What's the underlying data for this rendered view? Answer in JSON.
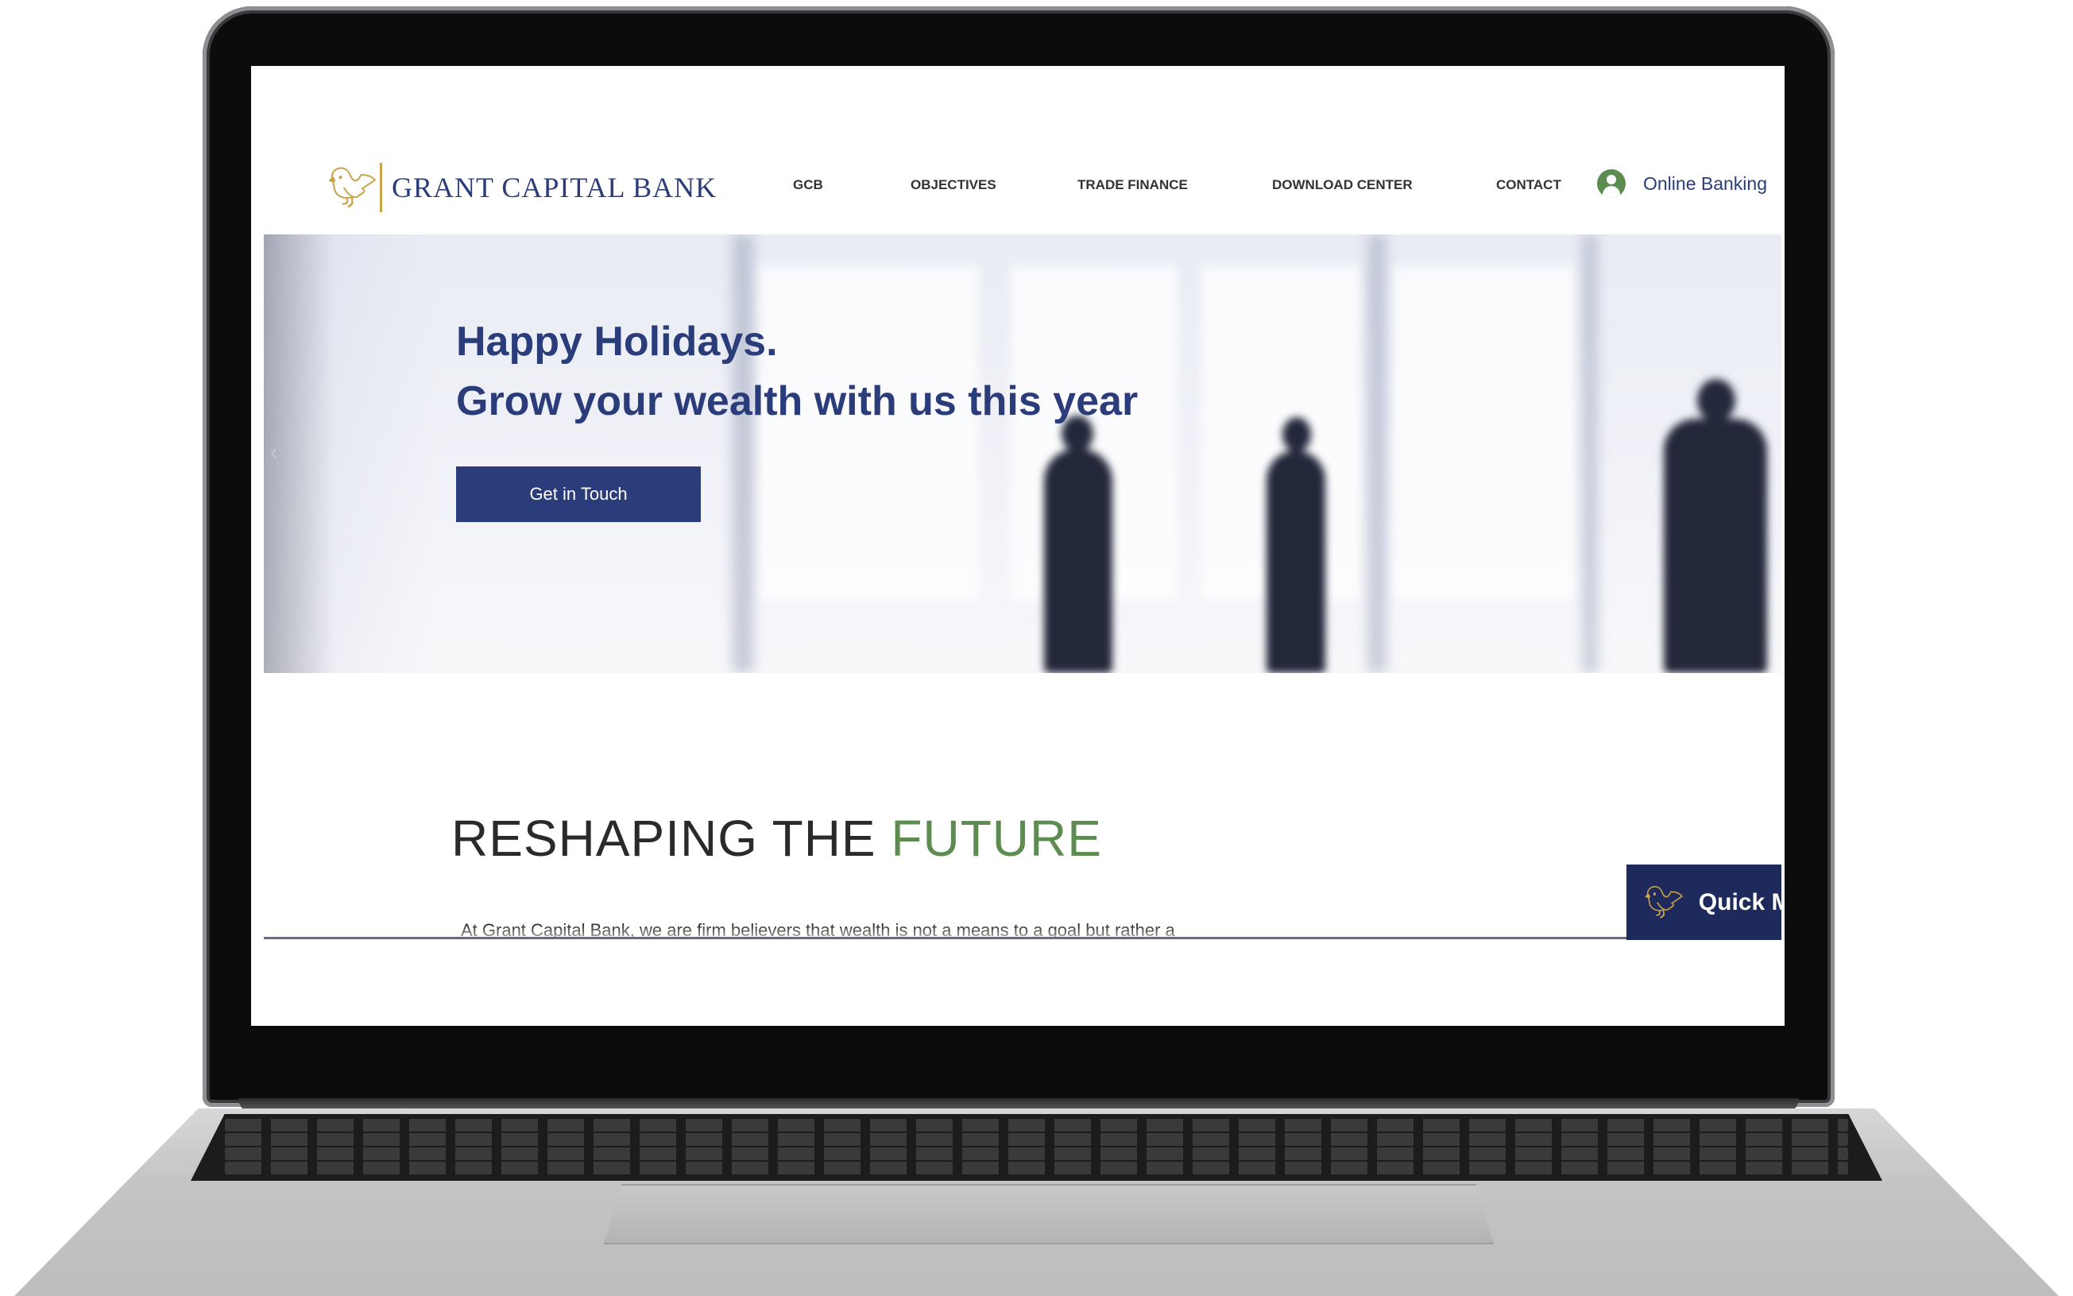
{
  "brand": {
    "name": "GRANT CAPITAL BANK",
    "logo_icon": "bird-logo-icon",
    "accent_color": "#c9a24a",
    "primary_color": "#2b3c7a"
  },
  "nav": {
    "items": [
      {
        "label": "GCB"
      },
      {
        "label": "OBJECTIVES"
      },
      {
        "label": "TRADE FINANCE"
      },
      {
        "label": "DOWNLOAD CENTER"
      },
      {
        "label": "CONTACT"
      }
    ],
    "online_banking": "Online Banking"
  },
  "hero": {
    "title_line1": "Happy Holidays.",
    "title_line2": "Grow your wealth with us this year",
    "cta_label": "Get in Touch",
    "slide_count": 2,
    "active_slide": 2
  },
  "section": {
    "title_part1": "RESHAPING THE ",
    "title_part2": "FUTURE",
    "title_accent_color": "#5d8c50",
    "intro_text": "At Grant Capital Bank, we are firm believers that wealth is not a means to a goal but rather a"
  },
  "quick_menu": {
    "label": "Quick M",
    "color": "#1f2a5c"
  }
}
